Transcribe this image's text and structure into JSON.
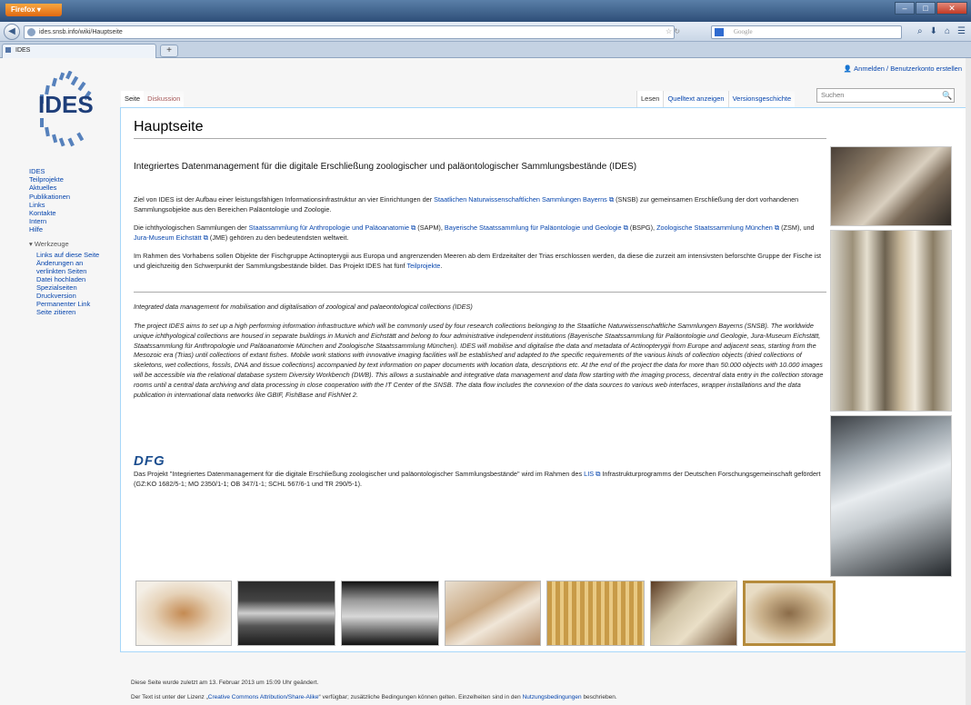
{
  "browser": {
    "app_button": "Firefox",
    "url": "ides.snsb.info/wiki/Hauptseite",
    "search_placeholder": "Google",
    "tab_title": "IDES",
    "new_tab": "+"
  },
  "personal": {
    "login_link": "Anmelden / Benutzerkonto erstellen"
  },
  "logo": {
    "text": "IDES"
  },
  "sidebar": {
    "nav": [
      "IDES",
      "Teilprojekte",
      "Aktuelles",
      "Publikationen",
      "Links",
      "Kontakte",
      "Intern",
      "Hilfe"
    ],
    "tools_heading": "Werkzeuge",
    "tools": [
      "Links auf diese Seite",
      "Änderungen an verlinkten Seiten",
      "Datei hochladen",
      "Spezialseiten",
      "Druckversion",
      "Permanenter Link",
      "Seite zitieren"
    ]
  },
  "tabs": {
    "page": "Seite",
    "discussion": "Diskussion",
    "read": "Lesen",
    "view_source": "Quelltext anzeigen",
    "history": "Versionsgeschichte",
    "search_placeholder": "Suchen"
  },
  "article": {
    "title": "Hauptseite",
    "intro_heading": "Integriertes Datenmanagement für die digitale Erschließung zoologischer und paläontologischer Sammlungsbestände (IDES)",
    "de_p1_a": "Ziel von IDES ist der Aufbau einer leistungsfähigen Informationsinfrastruktur an vier Einrichtungen der ",
    "de_p1_link": "Staatlichen Naturwissenschaftlichen Sammlungen Bayerns",
    "de_p1_b": " (SNSB) zur gemeinsamen Erschließung der dort vorhandenen Sammlungsobjekte aus den Bereichen Paläontologie und Zoologie.",
    "de_p2_a": "Die ichthyologischen Sammlungen der ",
    "de_p2_link1": "Staatssammlung für Anthropologie und Paläoanatomie",
    "de_p2_b": " (SAPM), ",
    "de_p2_link2": "Bayerische Staatssammlung für Paläontologie und Geologie",
    "de_p2_c": " (BSPG), ",
    "de_p2_link3": "Zoologische Staatssammlung München",
    "de_p2_d": " (ZSM), und ",
    "de_p2_link4": "Jura-Museum Eichstätt",
    "de_p2_e": " (JME) gehören zu den bedeutendsten weltweit.",
    "de_p3_a": "Im Rahmen des Vorhabens sollen Objekte der Fischgruppe Actinopterygii aus Europa und angrenzenden Meeren ab dem Erdzeitalter der Trias erschlossen werden, da diese die zurzeit am intensivsten beforschte Gruppe der Fische ist und gleichzeitig den Schwerpunkt der Sammlungsbestände bildet. Das Projekt IDES hat fünf ",
    "de_p3_link": "Teilprojekte",
    "de_p3_b": ".",
    "en_heading": "Integrated data management for mobilisation and digitalisation of zoological and palaeontological collections (IDES)",
    "en_p": "The project IDES aims to set up a high performing information infrastructure which will be commonly used by four research collections belonging to the Staatliche Naturwissenschaftliche Sammlungen Bayerns (SNSB). The worldwide unique ichthyological collections are housed in separate buildings in Munich and Eichstätt and belong to four administrative independent institutions (Bayerische Staatssammlung für Paläontologie und Geologie, Jura-Museum Eichstätt, Staatssammlung für Anthropologie und Paläoanatomie München and Zoologische Staatssammlung München). IDES will mobilise and digitalise the data and metadata of Actinopterygii from Europe and adjacent seas, starting from the Mesozoic era (Trias) until collections of extant fishes. Mobile work stations with innovative imaging facilities will be established and adapted to the specific requirements of the various kinds of collection objects (dried collections of skeletons, wet collections, fossils, DNA and tissue collections) accompanied by text information on paper documents with location data, descriptions etc. At the end of the project the data for more than 50.000 objects with 10.000 images will be accessible via the relational database system Diversity Workbench (DWB). This allows a sustainable and integrative data management and data flow starting with the imaging process, decentral data entry in the collection storage rooms until a central data archiving and data processing in close cooperation with the IT Center of the SNSB. The data flow includes the connexion of the data sources to various web interfaces, wrapper installations and the data publication in international data networks like GBIF, FishBase and FishNet 2.",
    "dfg_logo": "DFG",
    "dfg_p_a": "Das Projekt \"Integriertes Datenmanagement für die digitale Erschließung zoologischer und paläontologischer Sammlungsbestände\" wird im Rahmen des ",
    "dfg_p_link": "LIS",
    "dfg_p_b": " Infrastrukturprogramms der Deutschen Forschungsgemeinschaft gefördert (GZ:KO 1682/5-1; MO 2350/1-1; OB 347/1-1; SCHL 567/6-1 und TR 290/5-1)."
  },
  "footer": {
    "last_modified": "Diese Seite wurde zuletzt am 13. Februar 2013 um 15:09 Uhr geändert.",
    "license_a": "Der Text ist unter der Lizenz „",
    "license_link": "Creative Commons Attribution/Share-Alike",
    "license_b": "“ verfügbar; zusätzliche Bedingungen können gelten. Einzelheiten sind in den ",
    "terms_link": "Nutzungsbedingungen",
    "license_c": " beschrieben."
  }
}
